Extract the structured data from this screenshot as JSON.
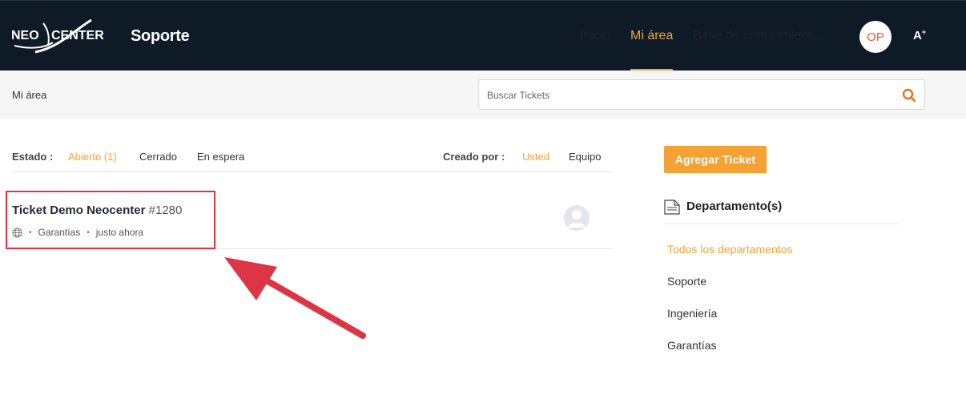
{
  "header": {
    "logo_text": "NEOCENTER",
    "logo_left": "NEO",
    "logo_right": "CENTER",
    "brand_sub": "Soporte",
    "nav": [
      {
        "label": "Inicio",
        "active": false
      },
      {
        "label": "Mi área",
        "active": true
      },
      {
        "label": "Base de conocimient…",
        "active": false
      }
    ],
    "avatar_initials": "OP",
    "font_toggle": "A",
    "font_toggle_sup": "+"
  },
  "subbar": {
    "breadcrumb": "Mi área",
    "search_placeholder": "Buscar Tickets"
  },
  "filters": {
    "estado_label": "Estado :",
    "estado_options": [
      {
        "label": "Abierto (1)",
        "active": true
      },
      {
        "label": "Cerrado",
        "active": false
      },
      {
        "label": "En espera",
        "active": false
      }
    ],
    "creado_label": "Creado por :",
    "creado_options": [
      {
        "label": "Usted",
        "active": true
      },
      {
        "label": "Equipo",
        "active": false
      }
    ]
  },
  "tickets": [
    {
      "title": "Ticket Demo Neocenter",
      "number": "#1280",
      "department": "Garantías",
      "time": "justo ahora",
      "separator": "•"
    }
  ],
  "sidebar": {
    "add_button": "Agregar Ticket",
    "departments_title": "Departamento(s)",
    "departments": [
      {
        "label": "Todos los departamentos",
        "active": true
      },
      {
        "label": "Soporte",
        "active": false
      },
      {
        "label": "Ingeniería",
        "active": false
      },
      {
        "label": "Garantías",
        "active": false
      }
    ]
  },
  "colors": {
    "header_bg": "#0f1a27",
    "accent": "#f5a234",
    "highlight": "#dc3545",
    "avatar_text": "#e55b2e"
  },
  "icons": [
    "neocenter-logo",
    "search-icon",
    "globe-icon",
    "user-avatar-icon",
    "document-icon",
    "arrow-annotation"
  ]
}
